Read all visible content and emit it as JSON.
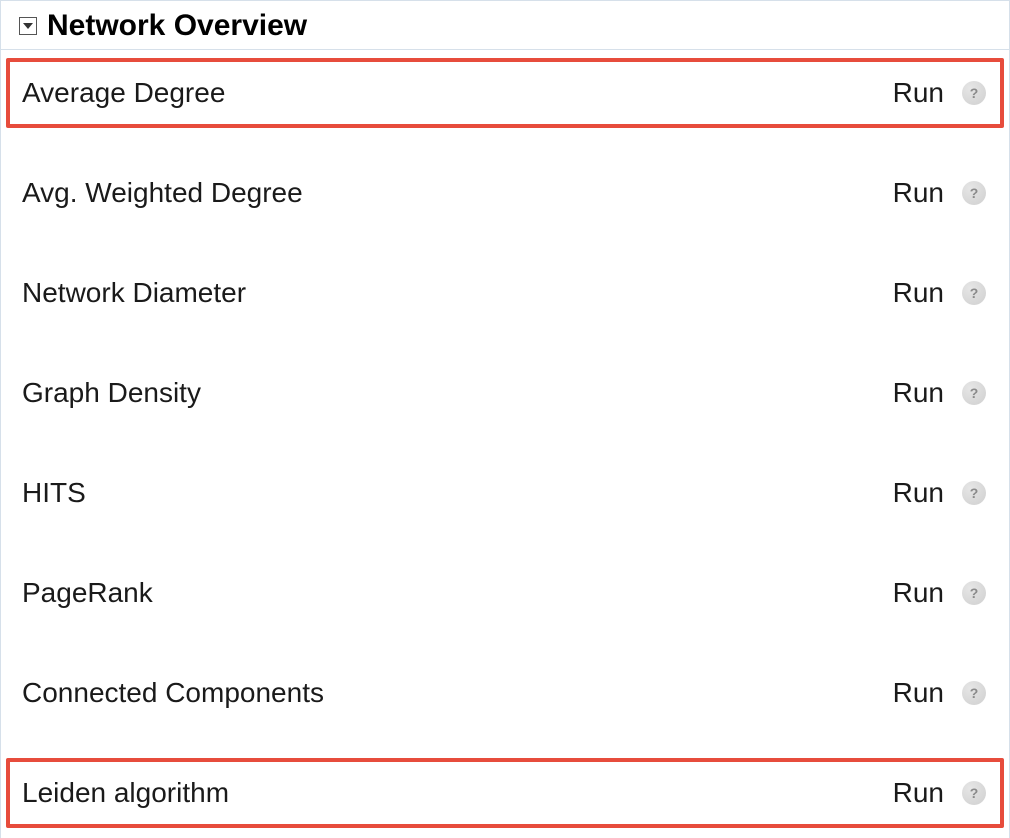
{
  "panel": {
    "title": "Network Overview",
    "runLabel": "Run",
    "items": [
      {
        "label": "Average Degree",
        "highlight": true
      },
      {
        "label": "Avg. Weighted Degree",
        "highlight": false
      },
      {
        "label": "Network Diameter",
        "highlight": false
      },
      {
        "label": "Graph Density",
        "highlight": false
      },
      {
        "label": "HITS",
        "highlight": false
      },
      {
        "label": "PageRank",
        "highlight": false
      },
      {
        "label": "Connected Components",
        "highlight": false
      },
      {
        "label": "Leiden algorithm",
        "highlight": true
      }
    ]
  }
}
